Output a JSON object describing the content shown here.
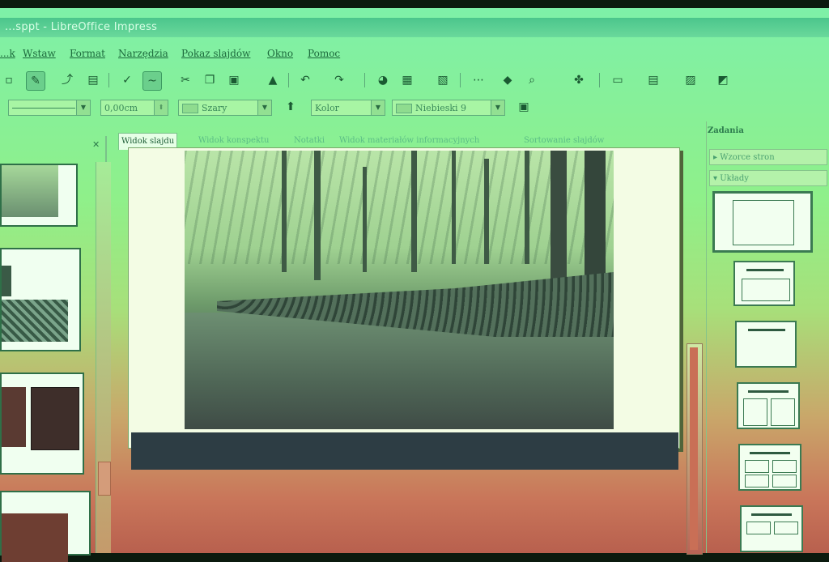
{
  "window": {
    "title": "...sppt - LibreOffice Impress"
  },
  "menu": {
    "items": [
      "...k",
      "Wstaw",
      "Format",
      "Narzędzia",
      "Pokaz slajdów",
      "Okno",
      "Pomoc"
    ]
  },
  "toolbar2": {
    "line_width": "0,00cm",
    "line_color": "Szary",
    "fill_type": "Kolor",
    "fill_color": "Niebieski 9"
  },
  "tabs": [
    {
      "label": "Widok slajdu",
      "active": true
    },
    {
      "label": "Widok konspektu",
      "active": false
    },
    {
      "label": "Notatki",
      "active": false
    },
    {
      "label": "Widok materiałów informacyjnych",
      "active": false
    },
    {
      "label": "Sortowanie slajdów",
      "active": false
    }
  ],
  "tasks_pane": {
    "title": "Zadania",
    "sections": [
      {
        "label": "▸ Wzorce stron"
      },
      {
        "label": "▾ Układy"
      }
    ]
  },
  "slide_pane": {
    "thumbnail_count": 4
  },
  "icons": [
    "pencil-icon",
    "cut-icon",
    "copy-icon",
    "paste-icon",
    "undo-icon",
    "redo-icon",
    "zoom-icon",
    "gallery-icon",
    "navigator-icon",
    "close-icon",
    "chevron-down-icon"
  ]
}
